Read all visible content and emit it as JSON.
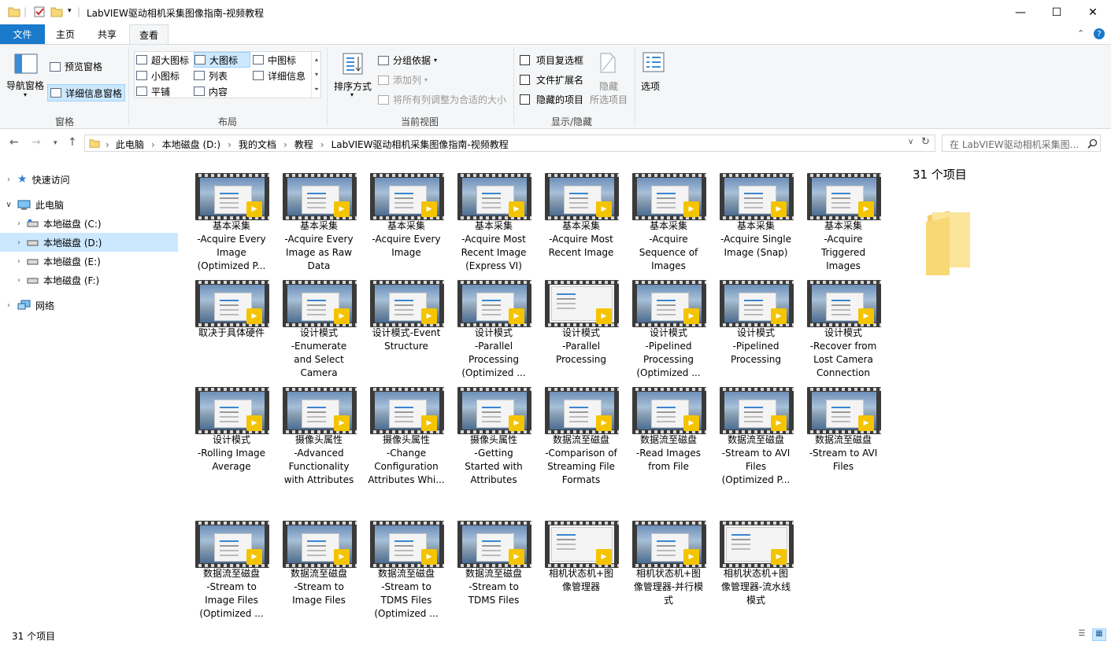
{
  "window": {
    "title": "LabVIEW驱动相机采集图像指南-视频教程",
    "minimize": "—",
    "maximize": "☐",
    "close": "✕"
  },
  "ribbon_tabs": {
    "file": "文件",
    "home": "主页",
    "share": "共享",
    "view": "查看"
  },
  "ribbon": {
    "panes": {
      "nav_pane": "导航窗格",
      "preview_pane": "预览窗格",
      "details_pane": "详细信息窗格",
      "label": "窗格"
    },
    "layout": {
      "items": [
        "超大图标",
        "大图标",
        "中图标",
        "小图标",
        "列表",
        "详细信息",
        "平铺",
        "内容"
      ],
      "selected": "大图标",
      "label": "布局"
    },
    "current_view": {
      "sort": "排序方式",
      "group_by": "分组依据",
      "add_column": "添加列",
      "fit_columns": "将所有列调整为合适的大小",
      "label": "当前视图"
    },
    "show_hide": {
      "item_checkboxes": "项目复选框",
      "file_extensions": "文件扩展名",
      "hidden_items": "隐藏的项目",
      "hide_selected_1": "隐藏",
      "hide_selected_2": "所选项目",
      "label": "显示/隐藏"
    },
    "options": "选项"
  },
  "address": {
    "crumbs": [
      "此电脑",
      "本地磁盘 (D:)",
      "我的文档",
      "教程",
      "LabVIEW驱动相机采集图像指南-视频教程"
    ],
    "search_placeholder": "在 LabVIEW驱动相机采集图...",
    "icons": [
      "back-arrow",
      "forward-arrow",
      "recent-chevron",
      "up-arrow",
      "refresh-icon",
      "search-icon"
    ]
  },
  "nav": [
    {
      "label": "快速访问",
      "icon": "star-icon"
    },
    {
      "label": "此电脑",
      "icon": "pc-icon"
    },
    {
      "label": "本地磁盘 (C:)",
      "icon": "drive-icon"
    },
    {
      "label": "本地磁盘 (D:)",
      "icon": "drive-icon",
      "selected": true
    },
    {
      "label": "本地磁盘 (E:)",
      "icon": "drive-icon"
    },
    {
      "label": "本地磁盘 (F:)",
      "icon": "drive-icon"
    },
    {
      "label": "网络",
      "icon": "network-icon"
    }
  ],
  "files": [
    {
      "l1": "基本采集",
      "l2": "-Acquire Every",
      "l3": "Image",
      "l4": "(Optimized P..."
    },
    {
      "l1": "基本采集",
      "l2": "-Acquire Every",
      "l3": "Image as Raw",
      "l4": "Data"
    },
    {
      "l1": "基本采集",
      "l2": "-Acquire Every",
      "l3": "Image",
      "l4": ""
    },
    {
      "l1": "基本采集",
      "l2": "-Acquire Most",
      "l3": "Recent Image",
      "l4": "(Express VI)"
    },
    {
      "l1": "基本采集",
      "l2": "-Acquire Most",
      "l3": "Recent Image",
      "l4": ""
    },
    {
      "l1": "基本采集",
      "l2": "-Acquire",
      "l3": "Sequence of",
      "l4": "Images"
    },
    {
      "l1": "基本采集",
      "l2": "-Acquire Single",
      "l3": "Image (Snap)",
      "l4": ""
    },
    {
      "l1": "基本采集",
      "l2": "-Acquire",
      "l3": "Triggered",
      "l4": "Images"
    },
    {
      "l1": "取决于具体硬件",
      "l2": "",
      "l3": "",
      "l4": ""
    },
    {
      "l1": "设计模式",
      "l2": "-Enumerate",
      "l3": "and Select",
      "l4": "Camera"
    },
    {
      "l1": "设计模式-Event",
      "l2": "Structure",
      "l3": "",
      "l4": ""
    },
    {
      "l1": "设计模式",
      "l2": "-Parallel",
      "l3": "Processing",
      "l4": "(Optimized ..."
    },
    {
      "l1": "设计模式",
      "l2": "-Parallel",
      "l3": "Processing",
      "l4": "",
      "doc": true
    },
    {
      "l1": "设计模式",
      "l2": "-Pipelined",
      "l3": "Processing",
      "l4": "(Optimized ..."
    },
    {
      "l1": "设计模式",
      "l2": "-Pipelined",
      "l3": "Processing",
      "l4": ""
    },
    {
      "l1": "设计模式",
      "l2": "-Recover from",
      "l3": "Lost Camera",
      "l4": "Connection"
    },
    {
      "l1": "设计模式",
      "l2": "-Rolling Image",
      "l3": "Average",
      "l4": ""
    },
    {
      "l1": "摄像头属性",
      "l2": "-Advanced",
      "l3": "Functionality",
      "l4": "with Attributes"
    },
    {
      "l1": "摄像头属性",
      "l2": "-Change",
      "l3": "Configuration",
      "l4": "Attributes Whi..."
    },
    {
      "l1": "摄像头属性",
      "l2": "-Getting",
      "l3": "Started with",
      "l4": "Attributes"
    },
    {
      "l1": "数据流至磁盘",
      "l2": "-Comparison of",
      "l3": "Streaming File",
      "l4": "Formats"
    },
    {
      "l1": "数据流至磁盘",
      "l2": "-Read Images",
      "l3": "from File",
      "l4": ""
    },
    {
      "l1": "数据流至磁盘",
      "l2": "-Stream to AVI",
      "l3": "Files",
      "l4": "(Optimized P..."
    },
    {
      "l1": "数据流至磁盘",
      "l2": "-Stream to AVI",
      "l3": "Files",
      "l4": ""
    },
    {
      "l1": "数据流至磁盘",
      "l2": "-Stream to",
      "l3": "Image Files",
      "l4": "(Optimized ..."
    },
    {
      "l1": "数据流至磁盘",
      "l2": "-Stream to",
      "l3": "Image Files",
      "l4": ""
    },
    {
      "l1": "数据流至磁盘",
      "l2": "-Stream to",
      "l3": "TDMS Files",
      "l4": "(Optimized ..."
    },
    {
      "l1": "数据流至磁盘",
      "l2": "-Stream to",
      "l3": "TDMS Files",
      "l4": ""
    },
    {
      "l1": "相机状态机+图",
      "l2": "像管理器",
      "l3": "",
      "l4": "",
      "doc": true
    },
    {
      "l1": "相机状态机+图",
      "l2": "像管理器-并行模",
      "l3": "式",
      "l4": ""
    },
    {
      "l1": "相机状态机+图",
      "l2": "像管理器-流水线",
      "l3": "模式",
      "l4": "",
      "doc": true
    }
  ],
  "player_badge": "Player",
  "details": {
    "count": "31 个项目"
  },
  "status": {
    "count": "31 个项目"
  }
}
